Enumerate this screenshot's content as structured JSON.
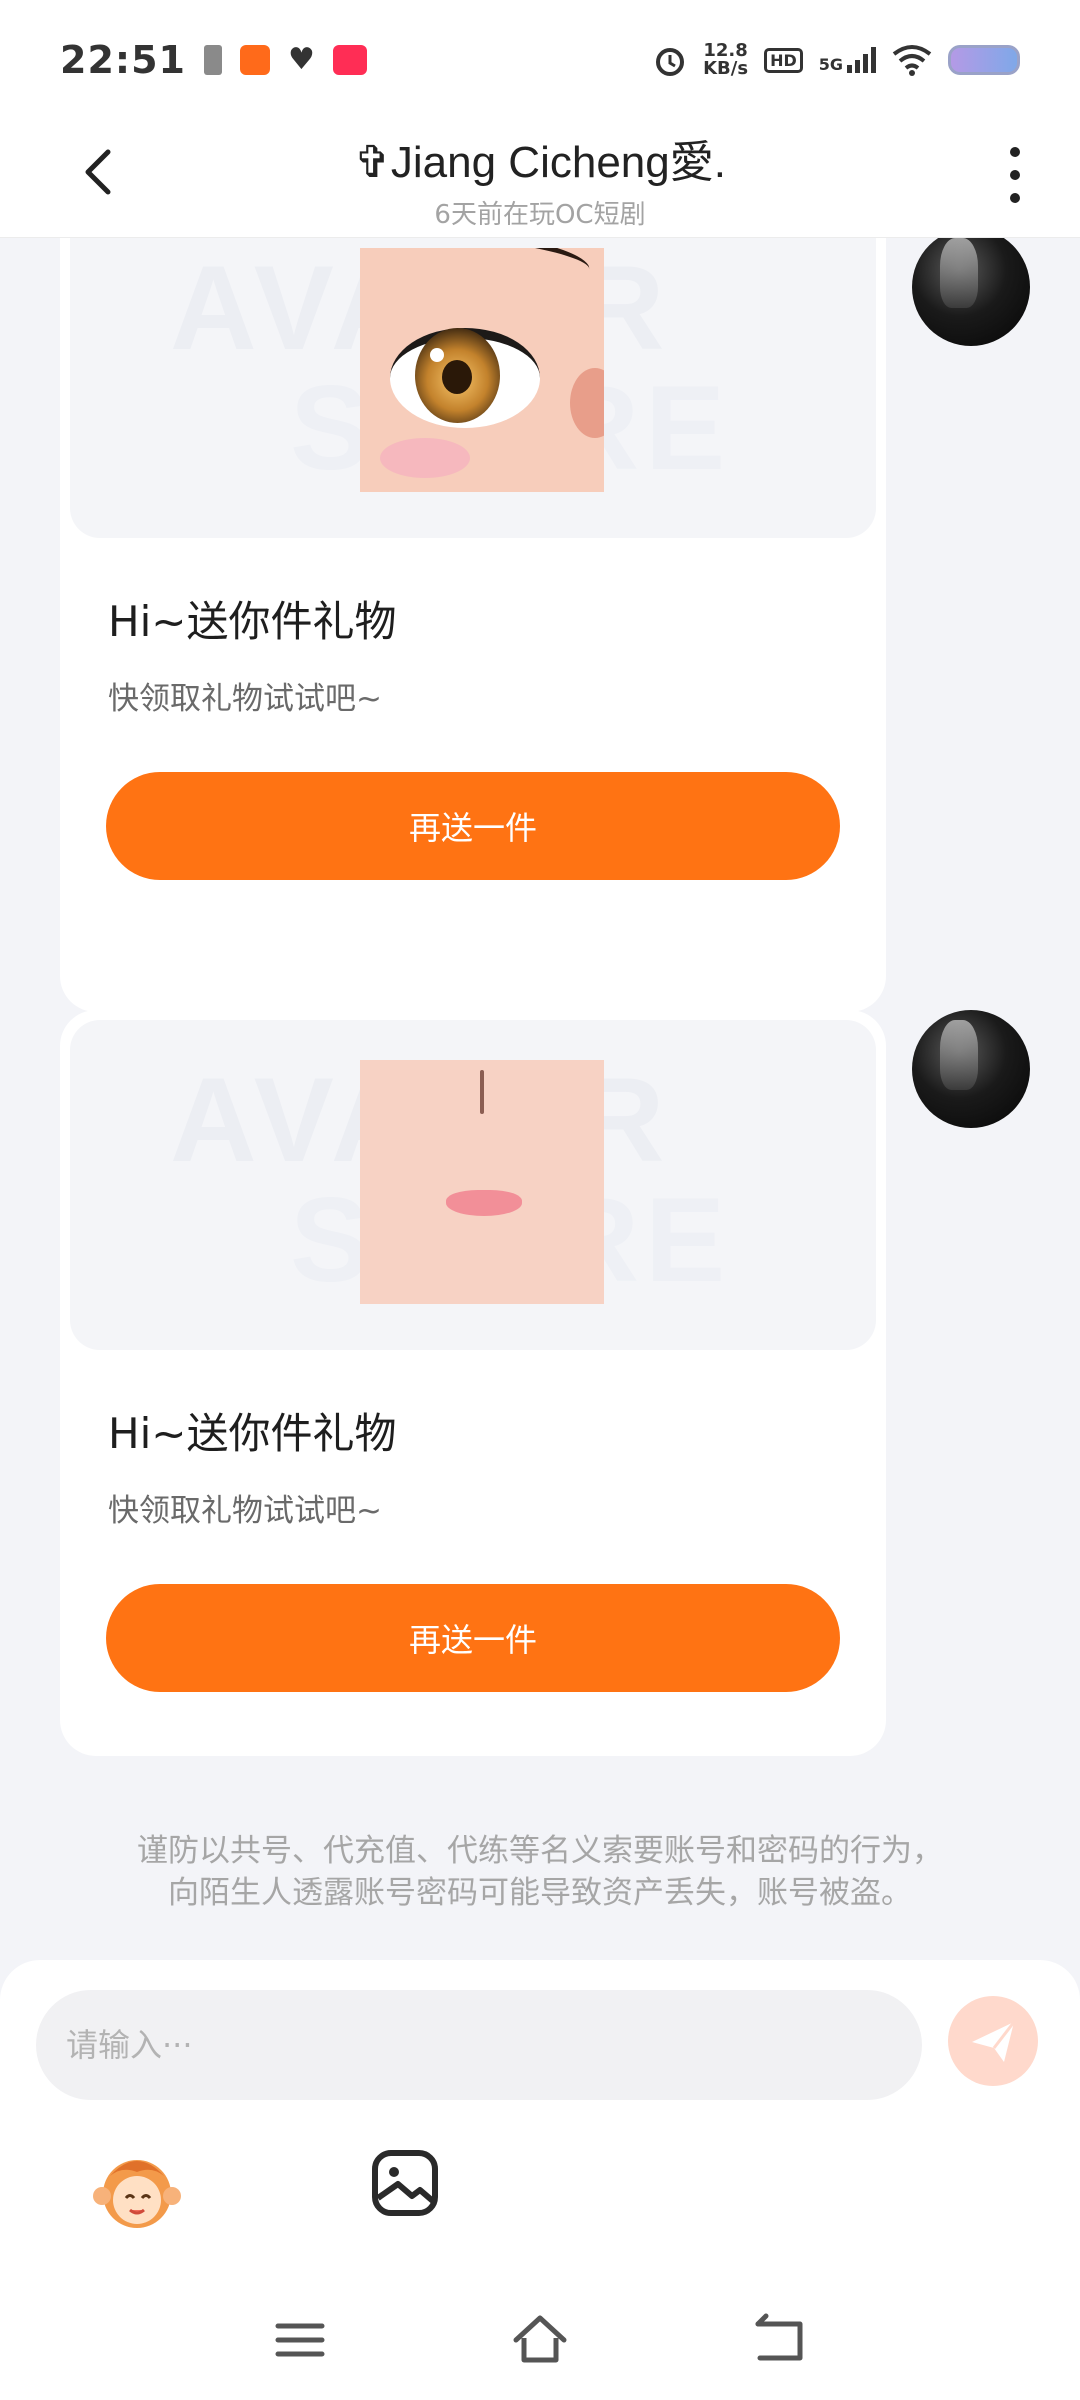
{
  "status_bar": {
    "time": "22:51",
    "speed_value": "12.8",
    "speed_unit": "KB/s",
    "hd_label": "HD",
    "network_label": "5G"
  },
  "header": {
    "title": "✞Jiang Cicheng愛.",
    "subtitle": "6天前在玩OC短剧"
  },
  "messages": [
    {
      "type": "gift",
      "image": "eye-art",
      "title": "Hi~送你件礼物",
      "subtitle": "快领取礼物试试吧~",
      "button_label": "再送一件"
    },
    {
      "type": "gift",
      "image": "lips-art",
      "title": "Hi~送你件礼物",
      "subtitle": "快领取礼物试试吧~",
      "button_label": "再送一件"
    }
  ],
  "notice": {
    "line1": "谨防以共号、代充值、代练等名义索要账号和密码的行为，",
    "line2": "向陌生人透露账号密码可能导致资产丢失，账号被盗。"
  },
  "input": {
    "placeholder": "请输入···",
    "value": ""
  },
  "colors": {
    "accent": "#ff7313",
    "send_disabled": "#ffd9cc",
    "background": "#f3f4f8"
  },
  "icons": [
    "back-arrow-icon",
    "more-vertical-icon",
    "send-icon",
    "mascot-emoji-icon",
    "image-icon",
    "menu-icon",
    "home-icon",
    "back-icon"
  ]
}
